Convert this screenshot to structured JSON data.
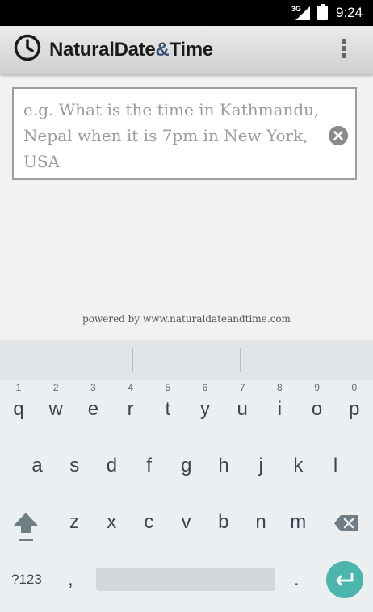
{
  "status_bar": {
    "network": "3G",
    "time": "9:24"
  },
  "app": {
    "title_part1": "NaturalDate",
    "title_amp": "&",
    "title_part2": "Time"
  },
  "query": {
    "value": "",
    "placeholder": "e.g. What is the time in Kathmandu, Nepal when it is 7pm in New York, USA"
  },
  "footer": {
    "powered_by": "powered by www.naturaldateandtime.com"
  },
  "keyboard": {
    "row1": [
      {
        "key": "q",
        "hint": "1"
      },
      {
        "key": "w",
        "hint": "2"
      },
      {
        "key": "e",
        "hint": "3"
      },
      {
        "key": "r",
        "hint": "4"
      },
      {
        "key": "t",
        "hint": "5"
      },
      {
        "key": "y",
        "hint": "6"
      },
      {
        "key": "u",
        "hint": "7"
      },
      {
        "key": "i",
        "hint": "8"
      },
      {
        "key": "o",
        "hint": "9"
      },
      {
        "key": "p",
        "hint": "0"
      }
    ],
    "row2": [
      "a",
      "s",
      "d",
      "f",
      "g",
      "h",
      "j",
      "k",
      "l"
    ],
    "row3": [
      "z",
      "x",
      "c",
      "v",
      "b",
      "n",
      "m"
    ],
    "symbols_label": "?123",
    "comma": ",",
    "period": ".",
    "accent_color": "#4db6ac"
  }
}
